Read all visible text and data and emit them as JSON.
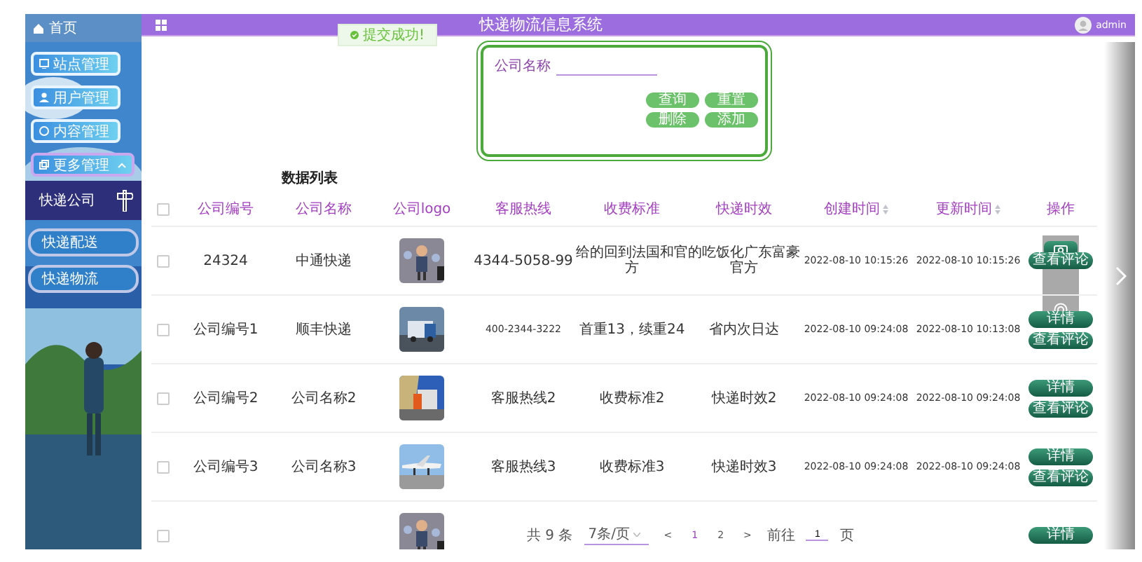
{
  "sidebar": {
    "home": {
      "label": "首页"
    },
    "items": [
      {
        "label": "站点管理"
      },
      {
        "label": "用户管理"
      },
      {
        "label": "内容管理"
      },
      {
        "label": "更多管理",
        "expanded": true,
        "children": [
          {
            "label": "快递公司",
            "selected": true
          },
          {
            "label": "快递配送",
            "selected": false
          },
          {
            "label": "快递物流",
            "selected": false
          }
        ]
      }
    ]
  },
  "header": {
    "title": "快递物流信息系统",
    "user": "admin"
  },
  "toast": {
    "message": "提交成功!"
  },
  "search": {
    "label": "公司名称",
    "buttons": [
      {
        "label": "查询"
      },
      {
        "label": "重置"
      },
      {
        "label": "删除"
      },
      {
        "label": "添加"
      }
    ]
  },
  "table": {
    "title": "数据列表",
    "columns": [
      {
        "label": "公司编号",
        "sortable": false
      },
      {
        "label": "公司名称",
        "sortable": false
      },
      {
        "label": "公司logo",
        "sortable": false
      },
      {
        "label": "客服热线",
        "sortable": false
      },
      {
        "label": "收费标准",
        "sortable": false
      },
      {
        "label": "快递时效",
        "sortable": false
      },
      {
        "label": "创建时间",
        "sortable": true
      },
      {
        "label": "更新时间",
        "sortable": true
      },
      {
        "label": "操作",
        "sortable": false
      }
    ],
    "rows": [
      {
        "checked": false,
        "cells": [
          "24324",
          "中通快递",
          {
            "kind": "picture"
          },
          "4344-5058-99",
          "给的回到法国和官方",
          "的吃饭化广东富豪官方",
          "2022-08-10 10:15:26",
          "2022-08-10 10:15:26"
        ],
        "actions": [
          "查看评论"
        ]
      },
      {
        "checked": false,
        "cells": [
          "公司编号1",
          "顺丰快递",
          {
            "kind": "picture"
          },
          "400-2344-3222",
          "首重13，续重24",
          "省内次日达",
          "2022-08-10 09:24:08",
          "2022-08-10 10:13:08"
        ],
        "actions": [
          "详情",
          "查看评论"
        ]
      },
      {
        "checked": false,
        "cells": [
          "公司编号2",
          "公司名称2",
          {
            "kind": "picture"
          },
          "客服热线2",
          "收费标准2",
          "快递时效2",
          "2022-08-10 09:24:08",
          "2022-08-10 09:24:08"
        ],
        "actions": [
          "详情",
          "查看评论"
        ]
      },
      {
        "checked": false,
        "cells": [
          "公司编号3",
          "公司名称3",
          {
            "kind": "picture"
          },
          "客服热线3",
          "收费标准3",
          "快递时效3",
          "2022-08-10 09:24:08",
          "2022-08-10 09:24:08"
        ],
        "actions": [
          "详情",
          "查看评论"
        ]
      },
      {
        "checked": false,
        "cells": [
          null,
          null,
          {
            "kind": "picture"
          },
          null,
          null,
          null,
          null,
          null
        ],
        "actions": [
          "详情"
        ]
      }
    ],
    "select_all_checked": false
  },
  "pagination": {
    "total": "共 9 条",
    "page_size": "7条/页",
    "prev": "<",
    "pages": [
      {
        "label": "1",
        "selected": true
      },
      {
        "label": "2",
        "selected": false
      }
    ],
    "next": ">",
    "goto_label": "前往",
    "goto_value": "1",
    "goto_unit": "页"
  }
}
